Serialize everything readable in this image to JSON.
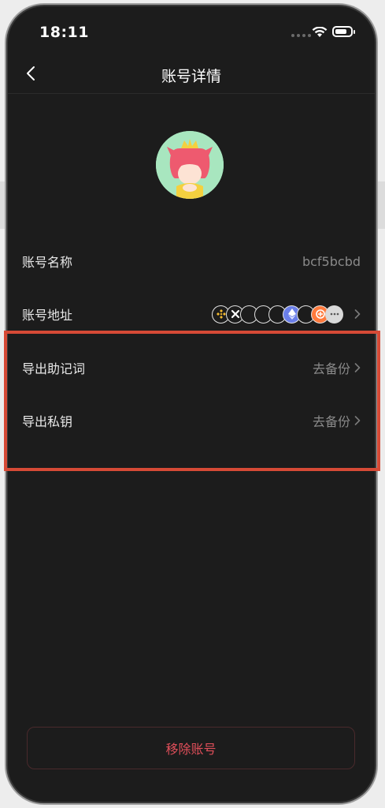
{
  "status_bar": {
    "time": "18:11"
  },
  "nav": {
    "title": "账号详情"
  },
  "account": {
    "name_label": "账号名称",
    "name_value": "bcf5bcbd",
    "address_label": "账号地址",
    "address_chain_icons": [
      "binance-icon",
      "x-chain-icon",
      "empty-coin-icon",
      "empty-coin-icon",
      "empty-coin-icon",
      "ethereum-icon",
      "empty-coin-icon",
      "orange-token-icon",
      "more-icon"
    ]
  },
  "backup": {
    "mnemonic_label": "导出助记词",
    "mnemonic_action": "去备份",
    "private_key_label": "导出私钥",
    "private_key_action": "去备份"
  },
  "footer": {
    "remove_label": "移除账号"
  },
  "colors": {
    "background": "#1c1c1c",
    "danger": "#e04f5a",
    "highlight": "#d64a36",
    "avatar_bg": "#a8e6bf"
  }
}
